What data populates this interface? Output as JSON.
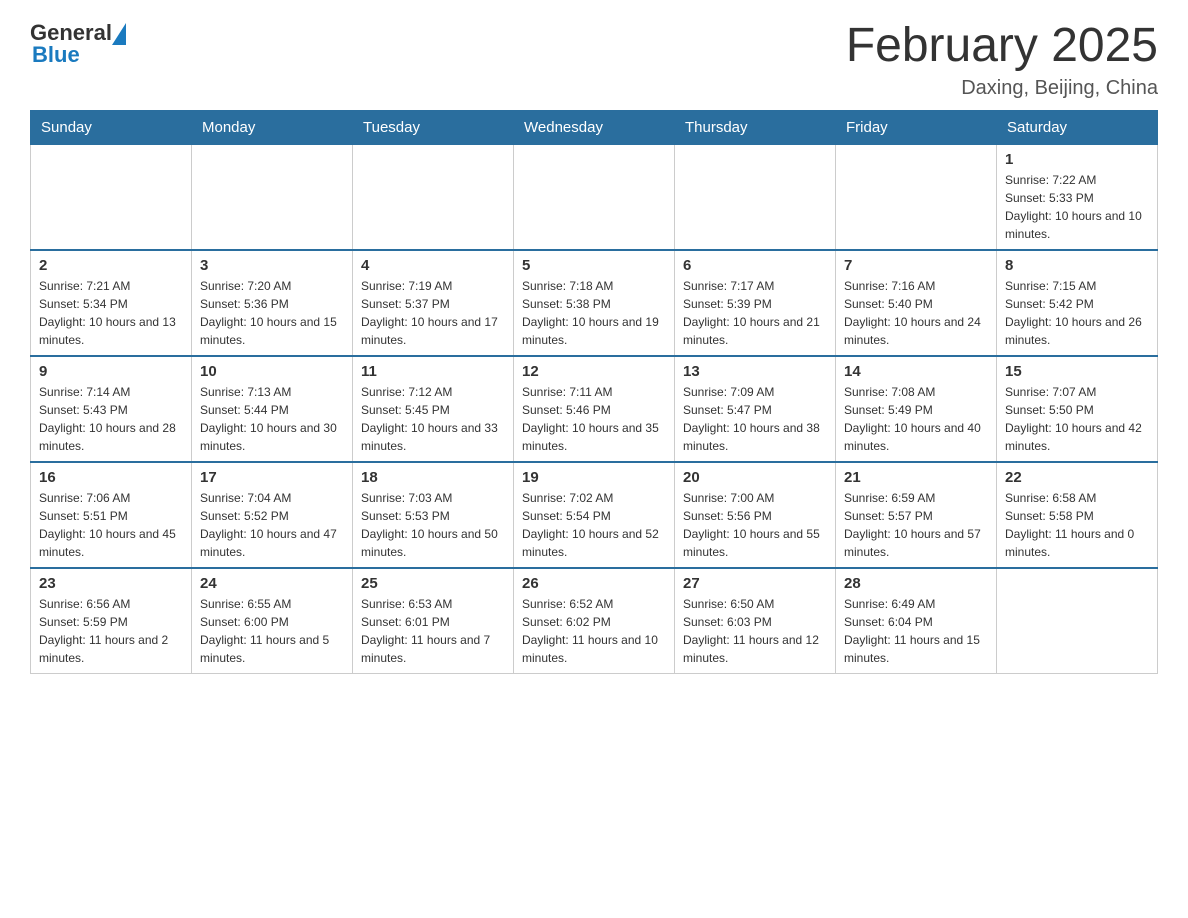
{
  "header": {
    "logo_general": "General",
    "logo_blue": "Blue",
    "month_title": "February 2025",
    "location": "Daxing, Beijing, China"
  },
  "weekdays": [
    "Sunday",
    "Monday",
    "Tuesday",
    "Wednesday",
    "Thursday",
    "Friday",
    "Saturday"
  ],
  "weeks": [
    {
      "days": [
        {
          "num": "",
          "info": ""
        },
        {
          "num": "",
          "info": ""
        },
        {
          "num": "",
          "info": ""
        },
        {
          "num": "",
          "info": ""
        },
        {
          "num": "",
          "info": ""
        },
        {
          "num": "",
          "info": ""
        },
        {
          "num": "1",
          "info": "Sunrise: 7:22 AM\nSunset: 5:33 PM\nDaylight: 10 hours and 10 minutes."
        }
      ]
    },
    {
      "days": [
        {
          "num": "2",
          "info": "Sunrise: 7:21 AM\nSunset: 5:34 PM\nDaylight: 10 hours and 13 minutes."
        },
        {
          "num": "3",
          "info": "Sunrise: 7:20 AM\nSunset: 5:36 PM\nDaylight: 10 hours and 15 minutes."
        },
        {
          "num": "4",
          "info": "Sunrise: 7:19 AM\nSunset: 5:37 PM\nDaylight: 10 hours and 17 minutes."
        },
        {
          "num": "5",
          "info": "Sunrise: 7:18 AM\nSunset: 5:38 PM\nDaylight: 10 hours and 19 minutes."
        },
        {
          "num": "6",
          "info": "Sunrise: 7:17 AM\nSunset: 5:39 PM\nDaylight: 10 hours and 21 minutes."
        },
        {
          "num": "7",
          "info": "Sunrise: 7:16 AM\nSunset: 5:40 PM\nDaylight: 10 hours and 24 minutes."
        },
        {
          "num": "8",
          "info": "Sunrise: 7:15 AM\nSunset: 5:42 PM\nDaylight: 10 hours and 26 minutes."
        }
      ]
    },
    {
      "days": [
        {
          "num": "9",
          "info": "Sunrise: 7:14 AM\nSunset: 5:43 PM\nDaylight: 10 hours and 28 minutes."
        },
        {
          "num": "10",
          "info": "Sunrise: 7:13 AM\nSunset: 5:44 PM\nDaylight: 10 hours and 30 minutes."
        },
        {
          "num": "11",
          "info": "Sunrise: 7:12 AM\nSunset: 5:45 PM\nDaylight: 10 hours and 33 minutes."
        },
        {
          "num": "12",
          "info": "Sunrise: 7:11 AM\nSunset: 5:46 PM\nDaylight: 10 hours and 35 minutes."
        },
        {
          "num": "13",
          "info": "Sunrise: 7:09 AM\nSunset: 5:47 PM\nDaylight: 10 hours and 38 minutes."
        },
        {
          "num": "14",
          "info": "Sunrise: 7:08 AM\nSunset: 5:49 PM\nDaylight: 10 hours and 40 minutes."
        },
        {
          "num": "15",
          "info": "Sunrise: 7:07 AM\nSunset: 5:50 PM\nDaylight: 10 hours and 42 minutes."
        }
      ]
    },
    {
      "days": [
        {
          "num": "16",
          "info": "Sunrise: 7:06 AM\nSunset: 5:51 PM\nDaylight: 10 hours and 45 minutes."
        },
        {
          "num": "17",
          "info": "Sunrise: 7:04 AM\nSunset: 5:52 PM\nDaylight: 10 hours and 47 minutes."
        },
        {
          "num": "18",
          "info": "Sunrise: 7:03 AM\nSunset: 5:53 PM\nDaylight: 10 hours and 50 minutes."
        },
        {
          "num": "19",
          "info": "Sunrise: 7:02 AM\nSunset: 5:54 PM\nDaylight: 10 hours and 52 minutes."
        },
        {
          "num": "20",
          "info": "Sunrise: 7:00 AM\nSunset: 5:56 PM\nDaylight: 10 hours and 55 minutes."
        },
        {
          "num": "21",
          "info": "Sunrise: 6:59 AM\nSunset: 5:57 PM\nDaylight: 10 hours and 57 minutes."
        },
        {
          "num": "22",
          "info": "Sunrise: 6:58 AM\nSunset: 5:58 PM\nDaylight: 11 hours and 0 minutes."
        }
      ]
    },
    {
      "days": [
        {
          "num": "23",
          "info": "Sunrise: 6:56 AM\nSunset: 5:59 PM\nDaylight: 11 hours and 2 minutes."
        },
        {
          "num": "24",
          "info": "Sunrise: 6:55 AM\nSunset: 6:00 PM\nDaylight: 11 hours and 5 minutes."
        },
        {
          "num": "25",
          "info": "Sunrise: 6:53 AM\nSunset: 6:01 PM\nDaylight: 11 hours and 7 minutes."
        },
        {
          "num": "26",
          "info": "Sunrise: 6:52 AM\nSunset: 6:02 PM\nDaylight: 11 hours and 10 minutes."
        },
        {
          "num": "27",
          "info": "Sunrise: 6:50 AM\nSunset: 6:03 PM\nDaylight: 11 hours and 12 minutes."
        },
        {
          "num": "28",
          "info": "Sunrise: 6:49 AM\nSunset: 6:04 PM\nDaylight: 11 hours and 15 minutes."
        },
        {
          "num": "",
          "info": ""
        }
      ]
    }
  ]
}
